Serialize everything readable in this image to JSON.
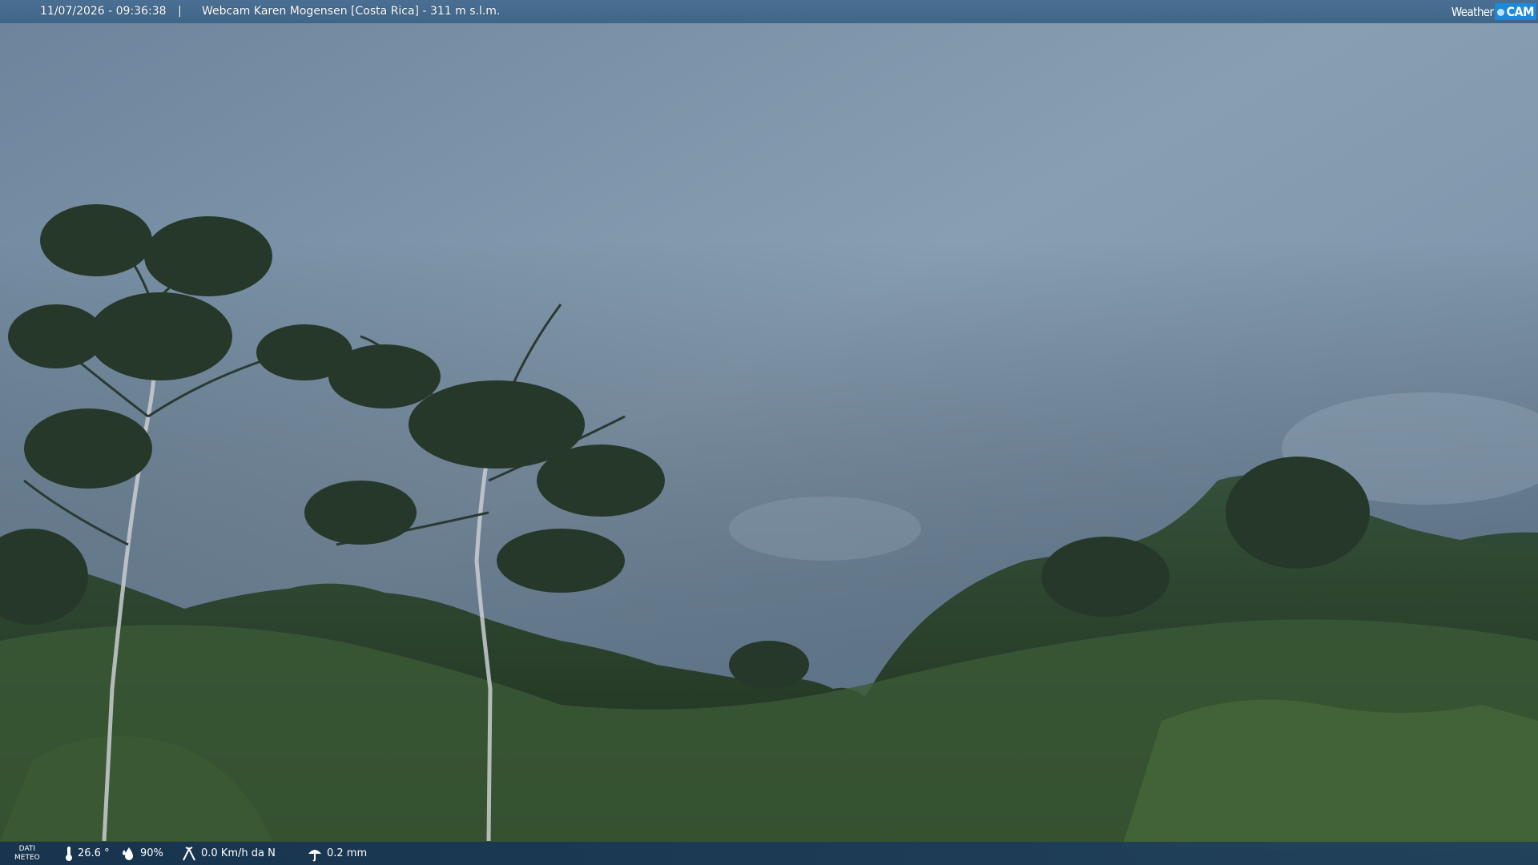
{
  "header": {
    "datetime": "11/07/2026 - 09:36:38",
    "separator": "|",
    "title": "Webcam Karen Mogensen [Costa Rica]  - 311 m s.l.m."
  },
  "logo": {
    "part1": "Weather",
    "part2": "CAM"
  },
  "weather": {
    "label_line1": "DATI",
    "label_line2": "METEO",
    "temperature": "26.6 °",
    "humidity": "90%",
    "wind": "0.0 Km/h da N",
    "rain": "0.2 mm"
  },
  "colors": {
    "bar": "#3f6588",
    "logo_accent": "#1c8ad9",
    "sky": "#7e97ad",
    "foliage": "#2d4a2a"
  }
}
